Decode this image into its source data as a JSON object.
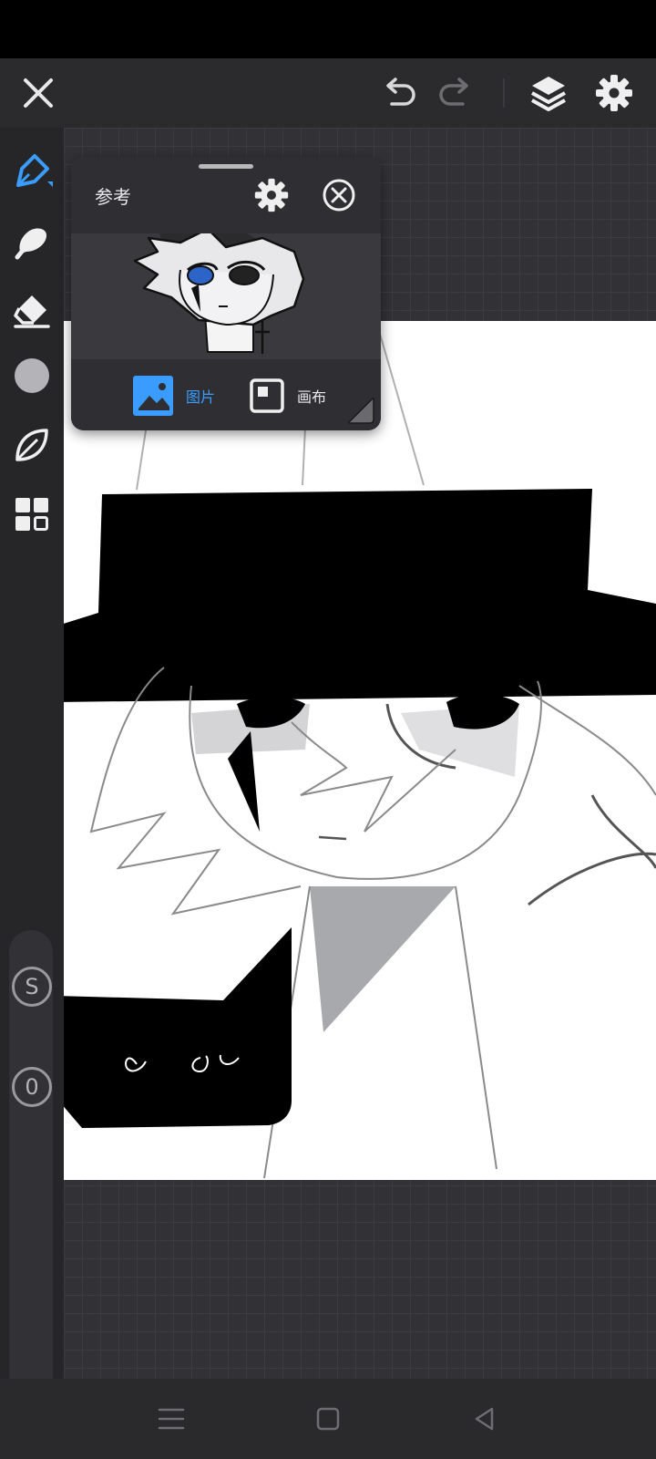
{
  "reference_panel": {
    "title": "参考",
    "tabs": [
      {
        "label": "图片",
        "selected": true
      },
      {
        "label": "画布",
        "selected": false
      }
    ]
  },
  "sidebar": {
    "tools": [
      {
        "icon": "pen-icon",
        "selected": true
      },
      {
        "icon": "smudge-brush-icon",
        "selected": false
      },
      {
        "icon": "eraser-icon",
        "selected": false
      },
      {
        "icon": "color-picker-icon",
        "selected": false
      },
      {
        "icon": "leaf-icon",
        "selected": false
      },
      {
        "icon": "grid-menu-icon",
        "selected": false
      }
    ],
    "size_button_label": "S",
    "opacity_button_label": "0"
  },
  "colors": {
    "accent": "#3b9cff",
    "toolbar": "#2b2b2e",
    "canvas": "#ffffff",
    "current_color": "#b4b4b8"
  }
}
